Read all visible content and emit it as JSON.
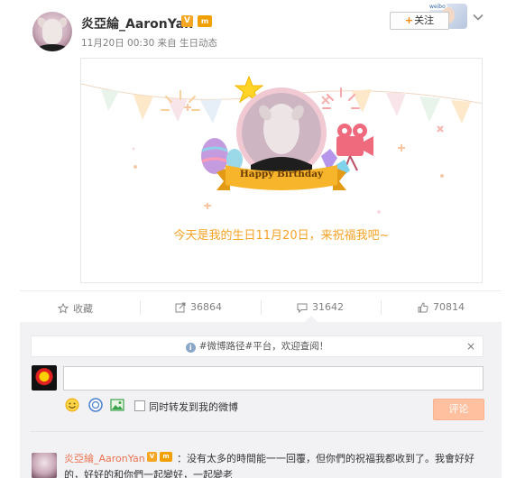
{
  "post": {
    "author": "炎亞綸_AaronYan",
    "verified_badge": "V",
    "vip_badge": "m",
    "meta": "11月20日 00:30 来自 生日动态",
    "follow_label": "关注",
    "follow_plus": "+",
    "follow_avatar_tag": "weibo"
  },
  "card": {
    "banner_text": "Happy Birthday",
    "message": "今天是我的生日11月20日，来祝福我吧~"
  },
  "actions": {
    "favorite_label": "收藏",
    "repost_count": "36864",
    "comment_count": "31642",
    "like_count": "70814"
  },
  "comments_panel": {
    "notice": "#微博路径#平台，欢迎查阅！",
    "notice_close": "×",
    "input_placeholder": "",
    "repost_label": "同时转发到我的微博",
    "submit_label": "评论"
  },
  "first_comment": {
    "author": "炎亞綸_AaronYan",
    "verified_badge": "V",
    "vip_badge": "m",
    "text": "：没有太多的時間能一一回覆，但你們的祝福我都收到了。我會好好的，好好的和你們一起變好，一起變老"
  },
  "colors": {
    "accent_orange": "#ff8200",
    "message_orange": "#f7a326",
    "comment_author": "#eb7350",
    "panel_bg": "#f2f2f5",
    "submit_bg": "#ffc09f"
  },
  "icons": [
    "chevron-down-icon",
    "star-icon",
    "repost-icon",
    "comment-icon",
    "like-icon",
    "info-icon",
    "emoji-icon",
    "topic-icon",
    "image-icon"
  ]
}
